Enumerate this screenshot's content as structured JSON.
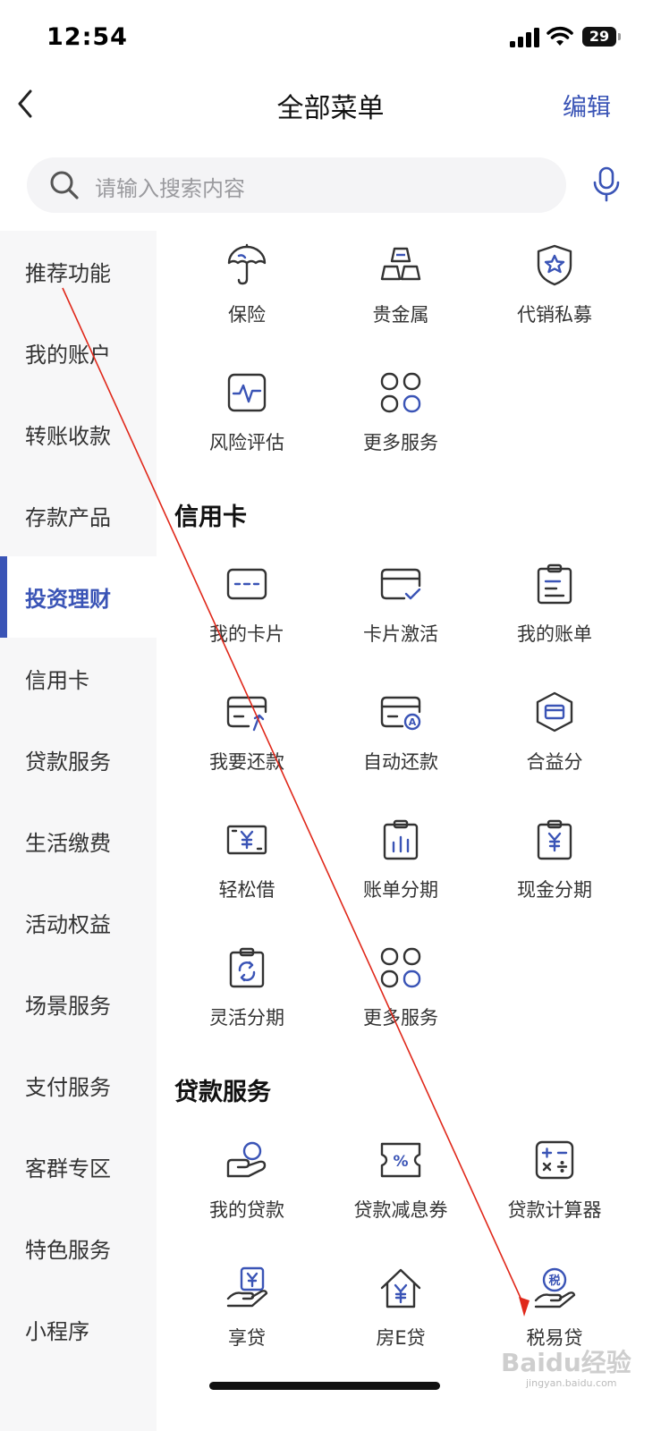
{
  "status_bar": {
    "time": "12:54",
    "battery": "29"
  },
  "nav": {
    "title": "全部菜单",
    "edit_label": "编辑"
  },
  "search": {
    "placeholder": "请输入搜索内容"
  },
  "sidebar": {
    "items": [
      {
        "label": "推荐功能"
      },
      {
        "label": "我的账户"
      },
      {
        "label": "转账收款"
      },
      {
        "label": "存款产品"
      },
      {
        "label": "投资理财",
        "active": true
      },
      {
        "label": "信用卡"
      },
      {
        "label": "贷款服务"
      },
      {
        "label": "生活缴费"
      },
      {
        "label": "活动权益"
      },
      {
        "label": "场景服务"
      },
      {
        "label": "支付服务"
      },
      {
        "label": "客群专区"
      },
      {
        "label": "特色服务"
      },
      {
        "label": "小程序"
      }
    ]
  },
  "investment": {
    "items": [
      {
        "label": "保险",
        "icon": "umbrella-icon"
      },
      {
        "label": "贵金属",
        "icon": "gold-bars-icon"
      },
      {
        "label": "代销私募",
        "icon": "shield-star-icon"
      },
      {
        "label": "风险评估",
        "icon": "pulse-monitor-icon"
      },
      {
        "label": "更多服务",
        "icon": "more-grid-icon"
      }
    ]
  },
  "credit_card": {
    "title": "信用卡",
    "items": [
      {
        "label": "我的卡片",
        "icon": "card-icon"
      },
      {
        "label": "卡片激活",
        "icon": "card-check-icon"
      },
      {
        "label": "我的账单",
        "icon": "bill-clipboard-icon"
      },
      {
        "label": "我要还款",
        "icon": "card-repay-icon"
      },
      {
        "label": "自动还款",
        "icon": "card-auto-icon"
      },
      {
        "label": "合益分",
        "icon": "hexagon-card-icon"
      },
      {
        "label": "轻松借",
        "icon": "cash-note-icon"
      },
      {
        "label": "账单分期",
        "icon": "bill-chart-icon"
      },
      {
        "label": "现金分期",
        "icon": "cash-clipboard-icon"
      },
      {
        "label": "灵活分期",
        "icon": "flex-clipboard-icon"
      },
      {
        "label": "更多服务",
        "icon": "more-grid-icon"
      }
    ]
  },
  "loan": {
    "title": "贷款服务",
    "items": [
      {
        "label": "我的贷款",
        "icon": "loan-hand-icon"
      },
      {
        "label": "贷款减息券",
        "icon": "coupon-percent-icon"
      },
      {
        "label": "贷款计算器",
        "icon": "calculator-icon"
      },
      {
        "label": "享贷",
        "icon": "hand-yuan-icon"
      },
      {
        "label": "房E贷",
        "icon": "house-yuan-icon"
      },
      {
        "label": "税易贷",
        "icon": "hand-tax-icon",
        "icon_text": "税"
      }
    ]
  },
  "watermark": {
    "brand": "Baidu经验",
    "url": "jingyan.baidu.com"
  },
  "colors": {
    "accent": "#3a54b6",
    "arrow": "#e0281a"
  }
}
